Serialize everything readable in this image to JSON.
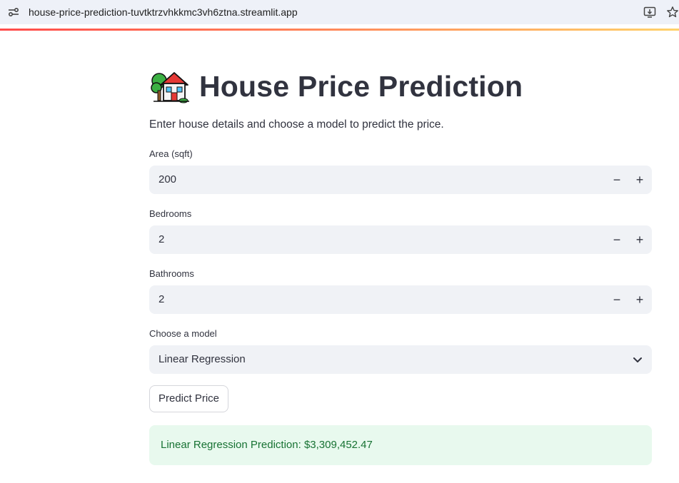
{
  "browser": {
    "url": "house-price-prediction-tuvtktrzvhkkmc3vh6ztna.streamlit.app"
  },
  "page": {
    "title": "House Price Prediction",
    "title_icon": "house-with-garden-emoji",
    "subtitle": "Enter house details and choose a model to predict the price."
  },
  "form": {
    "area": {
      "label": "Area (sqft)",
      "value": "200",
      "minus": "−",
      "plus": "+"
    },
    "bedrooms": {
      "label": "Bedrooms",
      "value": "2",
      "minus": "−",
      "plus": "+"
    },
    "bathrooms": {
      "label": "Bathrooms",
      "value": "2",
      "minus": "−",
      "plus": "+"
    },
    "model": {
      "label": "Choose a model",
      "selected": "Linear Regression"
    },
    "predict_label": "Predict Price"
  },
  "result": {
    "text": "Linear Regression Prediction: $3,309,452.47"
  },
  "colors": {
    "accent_gradient_start": "#ff4b4b",
    "accent_gradient_end": "#ffd26b",
    "input_bg": "#f0f2f6",
    "success_bg": "#e8f9ee",
    "success_text": "#177233",
    "text": "#31333f"
  }
}
